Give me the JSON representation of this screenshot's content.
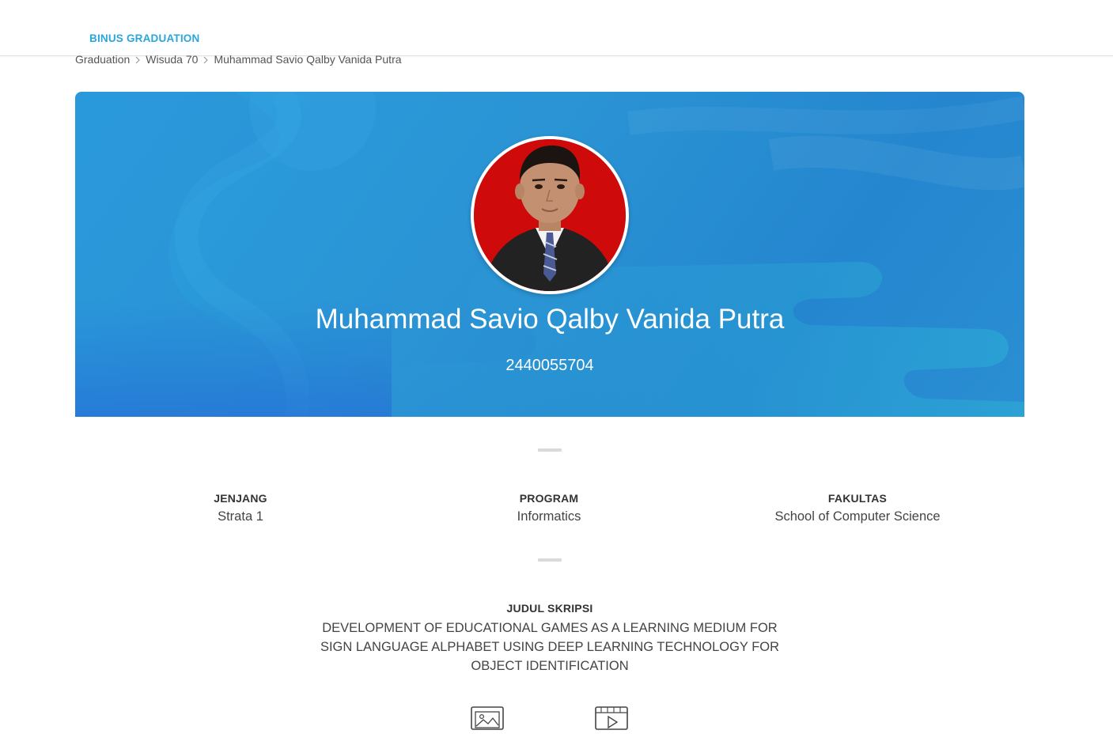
{
  "header": {
    "brand": "BINUS GRADUATION"
  },
  "breadcrumb": {
    "items": [
      "Graduation",
      "Wisuda 70",
      "Muhammad Savio Qalby Vanida Putra"
    ]
  },
  "profile": {
    "name": "Muhammad Savio Qalby Vanida Putra",
    "student_id": "2440055704",
    "photo_icon": "graduate-portrait"
  },
  "info": {
    "jenjang": {
      "label": "JENJANG",
      "value": "Strata 1"
    },
    "program": {
      "label": "PROGRAM",
      "value": "Informatics"
    },
    "fakultas": {
      "label": "FAKULTAS",
      "value": "School of Computer Science"
    }
  },
  "thesis": {
    "label": "JUDUL SKRIPSI",
    "title": "DEVELOPMENT OF EDUCATIONAL GAMES AS A LEARNING MEDIUM FOR SIGN LANGUAGE ALPHABET USING DEEP LEARNING TECHNOLOGY FOR OBJECT IDENTIFICATION"
  },
  "media": {
    "photo_icon": "image-gallery-icon",
    "video_icon": "video-player-icon"
  },
  "colors": {
    "brand": "#2aa6da",
    "hero": "#2a93d4",
    "avatar_bg": "#cf0a0a"
  }
}
